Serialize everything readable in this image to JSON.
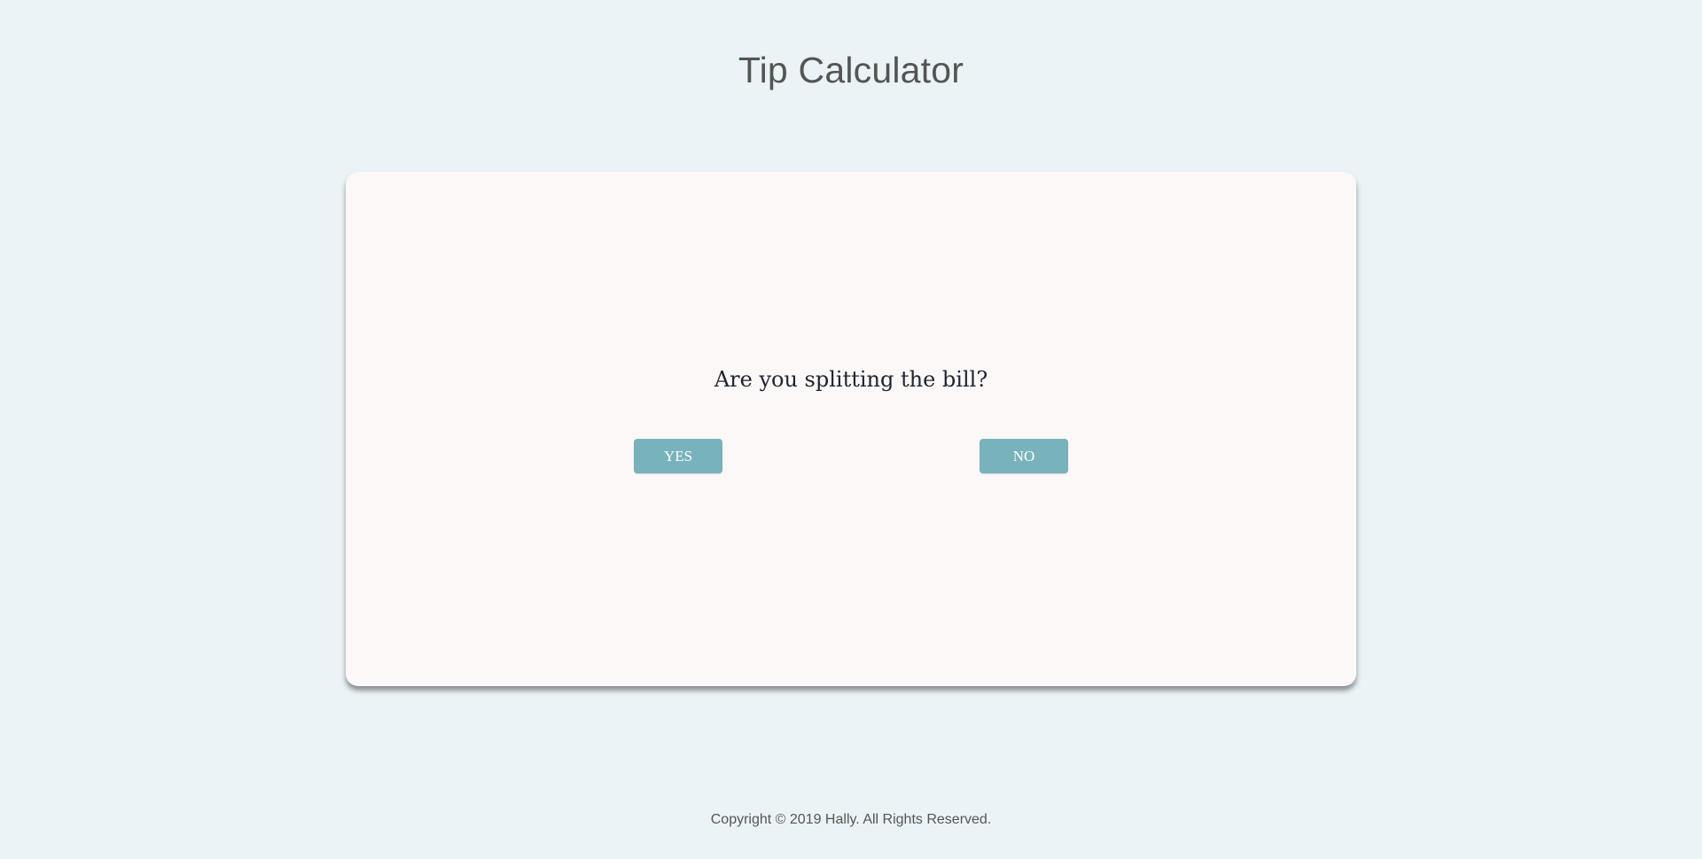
{
  "header": {
    "title": "Tip Calculator"
  },
  "card": {
    "question": "Are you splitting the bill?",
    "yes_label": "YES",
    "no_label": "NO"
  },
  "footer": {
    "copyright": "Copyright © 2019 Hally. All Rights Reserved."
  },
  "colors": {
    "background": "#eaf4f6",
    "card": "#fbf8f7",
    "button": "#78b3bd",
    "title_text": "#555555",
    "question_text": "#1f2430"
  }
}
